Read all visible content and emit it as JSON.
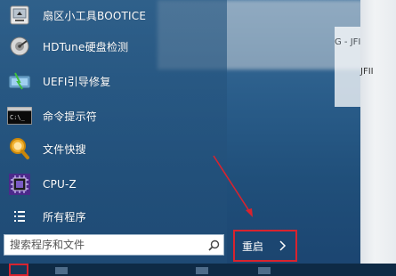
{
  "start_menu": {
    "items": [
      {
        "label": "扇区小工具BOOTICE",
        "icon": "bootice-icon"
      },
      {
        "label": "HDTune硬盘检测",
        "icon": "hdtune-icon"
      },
      {
        "label": "UEFI引导修复",
        "icon": "uefi-repair-icon"
      },
      {
        "label": "命令提示符",
        "icon": "command-prompt-icon"
      },
      {
        "label": "文件快搜",
        "icon": "file-search-icon"
      },
      {
        "label": "CPU-Z",
        "icon": "cpuz-icon"
      },
      {
        "label": "所有程序",
        "icon": "all-programs-icon"
      }
    ],
    "search_placeholder": "搜索程序和文件",
    "restart_label": "重启"
  },
  "background": {
    "fragment_1": "G - JFI",
    "fragment_2": "JFII"
  },
  "colors": {
    "highlight_red": "#d9232e",
    "menu_text": "#ffffff"
  }
}
